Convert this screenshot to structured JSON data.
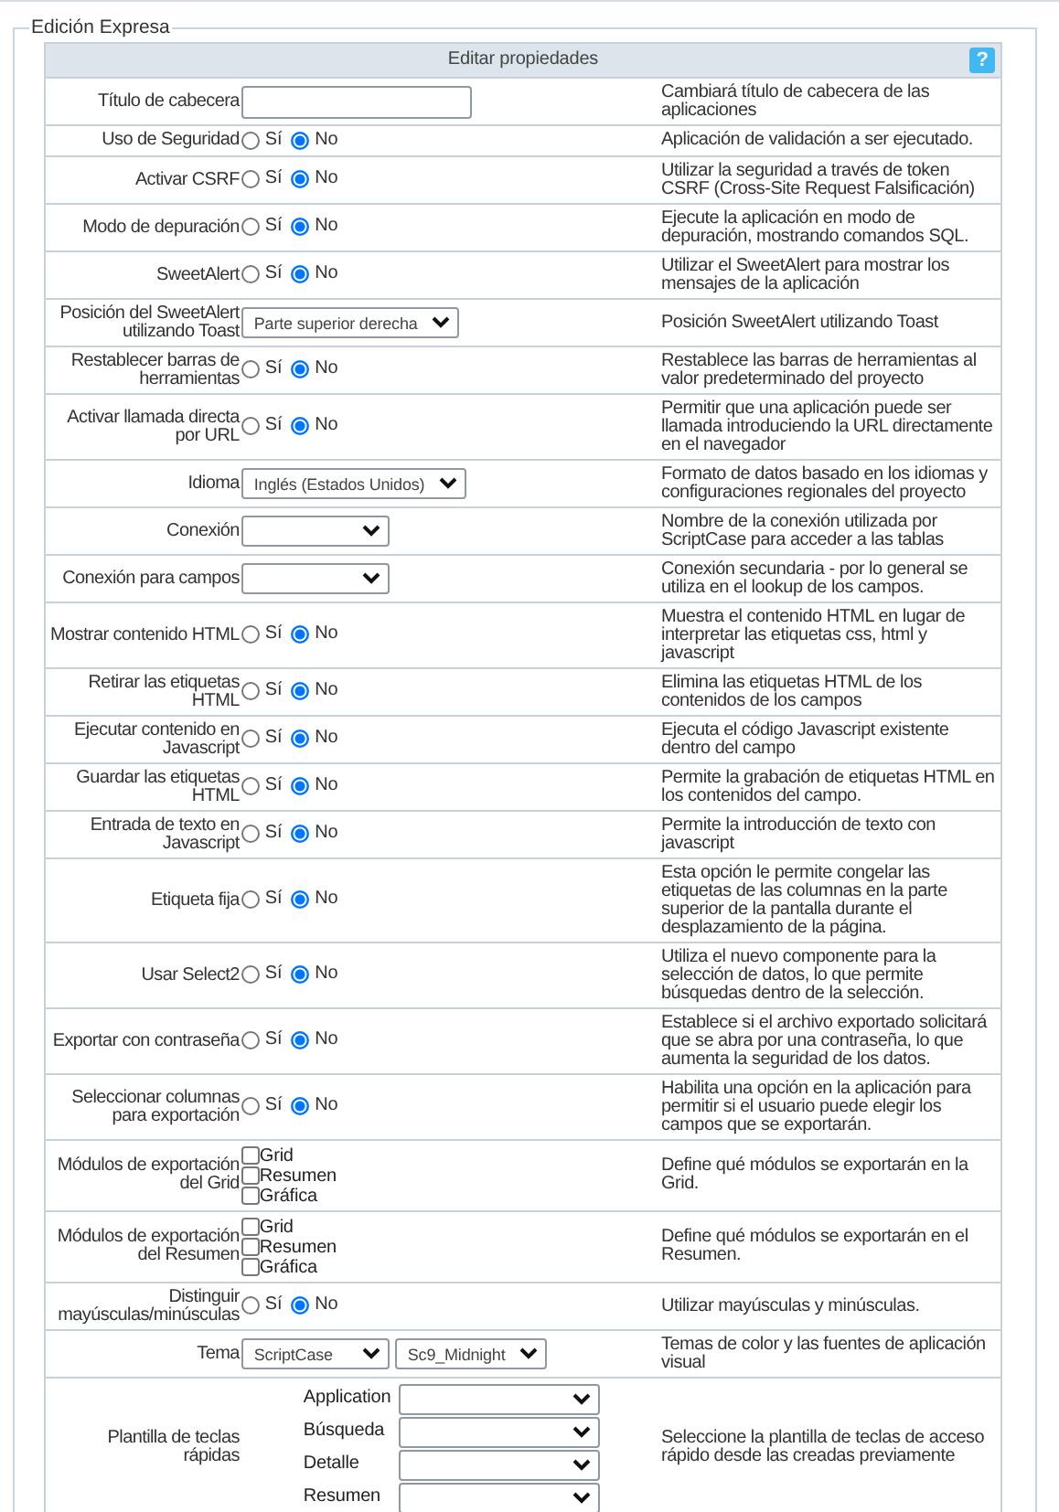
{
  "panel": {
    "legend": "Edición Expresa"
  },
  "header": {
    "title": "Editar propiedades",
    "help": "?"
  },
  "rows": [
    {
      "kind": "text",
      "label": "Título de cabecera",
      "value": "",
      "description": "Cambiará título de cabecera de las aplicaciones"
    },
    {
      "kind": "radio",
      "label": "Uso de Seguridad",
      "options": [
        {
          "label": "Sí",
          "selected": false
        },
        {
          "label": "No",
          "selected": true
        }
      ],
      "description": "Aplicación de validación a ser ejecutado."
    },
    {
      "kind": "radio",
      "label": "Activar CSRF",
      "options": [
        {
          "label": "Sí",
          "selected": false
        },
        {
          "label": "No",
          "selected": true
        }
      ],
      "description": "Utilizar la seguridad a través de token CSRF (Cross-Site Request Falsificación)"
    },
    {
      "kind": "radio",
      "label": "Modo de depuración",
      "options": [
        {
          "label": "Sí",
          "selected": false
        },
        {
          "label": "No",
          "selected": true
        }
      ],
      "description": "Ejecute la aplicación en modo de depuración, mostrando comandos SQL."
    },
    {
      "kind": "radio",
      "label": "SweetAlert",
      "options": [
        {
          "label": "Sí",
          "selected": false
        },
        {
          "label": "No",
          "selected": true
        }
      ],
      "description": "Utilizar el SweetAlert para mostrar los mensajes de la aplicación"
    },
    {
      "kind": "select",
      "label": "Posición del SweetAlert utilizando Toast",
      "selects": [
        {
          "value": "Parte superior derecha"
        }
      ],
      "description": "Posición SweetAlert utilizando Toast"
    },
    {
      "kind": "radio",
      "label": "Restablecer barras de herramientas",
      "options": [
        {
          "label": "Sí",
          "selected": false
        },
        {
          "label": "No",
          "selected": true
        }
      ],
      "description": "Restablece las barras de herramientas al valor predeterminado del proyecto"
    },
    {
      "kind": "radio",
      "label": "Activar llamada directa por URL",
      "options": [
        {
          "label": "Sí",
          "selected": false
        },
        {
          "label": "No",
          "selected": true
        }
      ],
      "description": "Permitir que una aplicación puede ser llamada introduciendo la URL directamente en el navegador"
    },
    {
      "kind": "select",
      "label": "Idioma",
      "selects": [
        {
          "value": "Inglés (Estados Unidos)"
        }
      ],
      "description": "Formato de datos basado en los idiomas y configuraciones regionales del proyecto"
    },
    {
      "kind": "blank_select",
      "label": "Conexión",
      "description": "Nombre de la conexión utilizada por ScriptCase para acceder a las tablas"
    },
    {
      "kind": "blank_select",
      "label": "Conexión para campos",
      "description": "Conexión secundaria - por lo general se utiliza en el lookup de los campos."
    },
    {
      "kind": "radio",
      "label": "Mostrar contenido HTML",
      "options": [
        {
          "label": "Sí",
          "selected": false
        },
        {
          "label": "No",
          "selected": true
        }
      ],
      "description": "Muestra el contenido HTML en lugar de interpretar las etiquetas css, html y javascript"
    },
    {
      "kind": "radio",
      "label": "Retirar las etiquetas HTML",
      "options": [
        {
          "label": "Sí",
          "selected": false
        },
        {
          "label": "No",
          "selected": true
        }
      ],
      "description": "Elimina las etiquetas HTML de los contenidos de los campos"
    },
    {
      "kind": "radio",
      "label": "Ejecutar contenido en Javascript",
      "options": [
        {
          "label": "Sí",
          "selected": false
        },
        {
          "label": "No",
          "selected": true
        }
      ],
      "description": "Ejecuta el código Javascript existente dentro del campo"
    },
    {
      "kind": "radio",
      "label": "Guardar las etiquetas HTML",
      "options": [
        {
          "label": "Sí",
          "selected": false
        },
        {
          "label": "No",
          "selected": true
        }
      ],
      "description": "Permite la grabación de etiquetas HTML en los contenidos del campo."
    },
    {
      "kind": "radio",
      "label": "Entrada de texto en Javascript",
      "options": [
        {
          "label": "Sí",
          "selected": false
        },
        {
          "label": "No",
          "selected": true
        }
      ],
      "description": "Permite la introducción de texto con javascript"
    },
    {
      "kind": "radio",
      "label": "Etiqueta fija",
      "options": [
        {
          "label": "Sí",
          "selected": false
        },
        {
          "label": "No",
          "selected": true
        }
      ],
      "description": "Esta opción le permite congelar las etiquetas de las columnas en la parte superior de la pantalla durante el desplazamiento de la página."
    },
    {
      "kind": "radio",
      "label": "Usar Select2",
      "options": [
        {
          "label": "Sí",
          "selected": false
        },
        {
          "label": "No",
          "selected": true
        }
      ],
      "description": "Utiliza el nuevo componente para la selección de datos, lo que permite búsquedas dentro de la selección."
    },
    {
      "kind": "radio",
      "label": "Exportar con contraseña",
      "options": [
        {
          "label": "Sí",
          "selected": false
        },
        {
          "label": "No",
          "selected": true
        }
      ],
      "description": "Establece si el archivo exportado solicitará que se abra por una contraseña, lo que aumenta la seguridad de los datos."
    },
    {
      "kind": "radio",
      "label": "Seleccionar columnas para exportación",
      "options": [
        {
          "label": "Sí",
          "selected": false
        },
        {
          "label": "No",
          "selected": true
        }
      ],
      "description": "Habilita una opción en la aplicación para permitir si el usuario puede elegir los campos que se exportarán."
    },
    {
      "kind": "checks",
      "label": "Módulos de exportación del Grid",
      "options": [
        {
          "label": "Grid",
          "checked": false
        },
        {
          "label": "Resumen",
          "checked": false
        },
        {
          "label": "Gráfica",
          "checked": false
        }
      ],
      "description": "Define qué módulos se exportarán en la Grid."
    },
    {
      "kind": "checks",
      "label": "Módulos de exportación del Resumen",
      "options": [
        {
          "label": "Grid",
          "checked": false
        },
        {
          "label": "Resumen",
          "checked": false
        },
        {
          "label": "Gráfica",
          "checked": false
        }
      ],
      "description": "Define qué módulos se exportarán en el Resumen."
    },
    {
      "kind": "radio",
      "label": "Distinguir mayúsculas/minúsculas",
      "options": [
        {
          "label": "Sí",
          "selected": false
        },
        {
          "label": "No",
          "selected": true
        }
      ],
      "description": "Utilizar mayúsculas y minúsculas."
    },
    {
      "kind": "select",
      "label": "Tema",
      "selects": [
        {
          "value": "ScriptCase"
        },
        {
          "value": "Sc9_Midnight"
        }
      ],
      "description": "Temas de color y las fuentes de aplicación visual"
    },
    {
      "kind": "hotkeys",
      "label": "Plantilla de teclas rápidas",
      "items": [
        {
          "label": "Application"
        },
        {
          "label": "Búsqueda"
        },
        {
          "label": "Detalle"
        },
        {
          "label": "Resumen"
        }
      ],
      "description": "Seleccione la plantilla de teclas de acceso rápido desde las creadas previamente"
    }
  ]
}
